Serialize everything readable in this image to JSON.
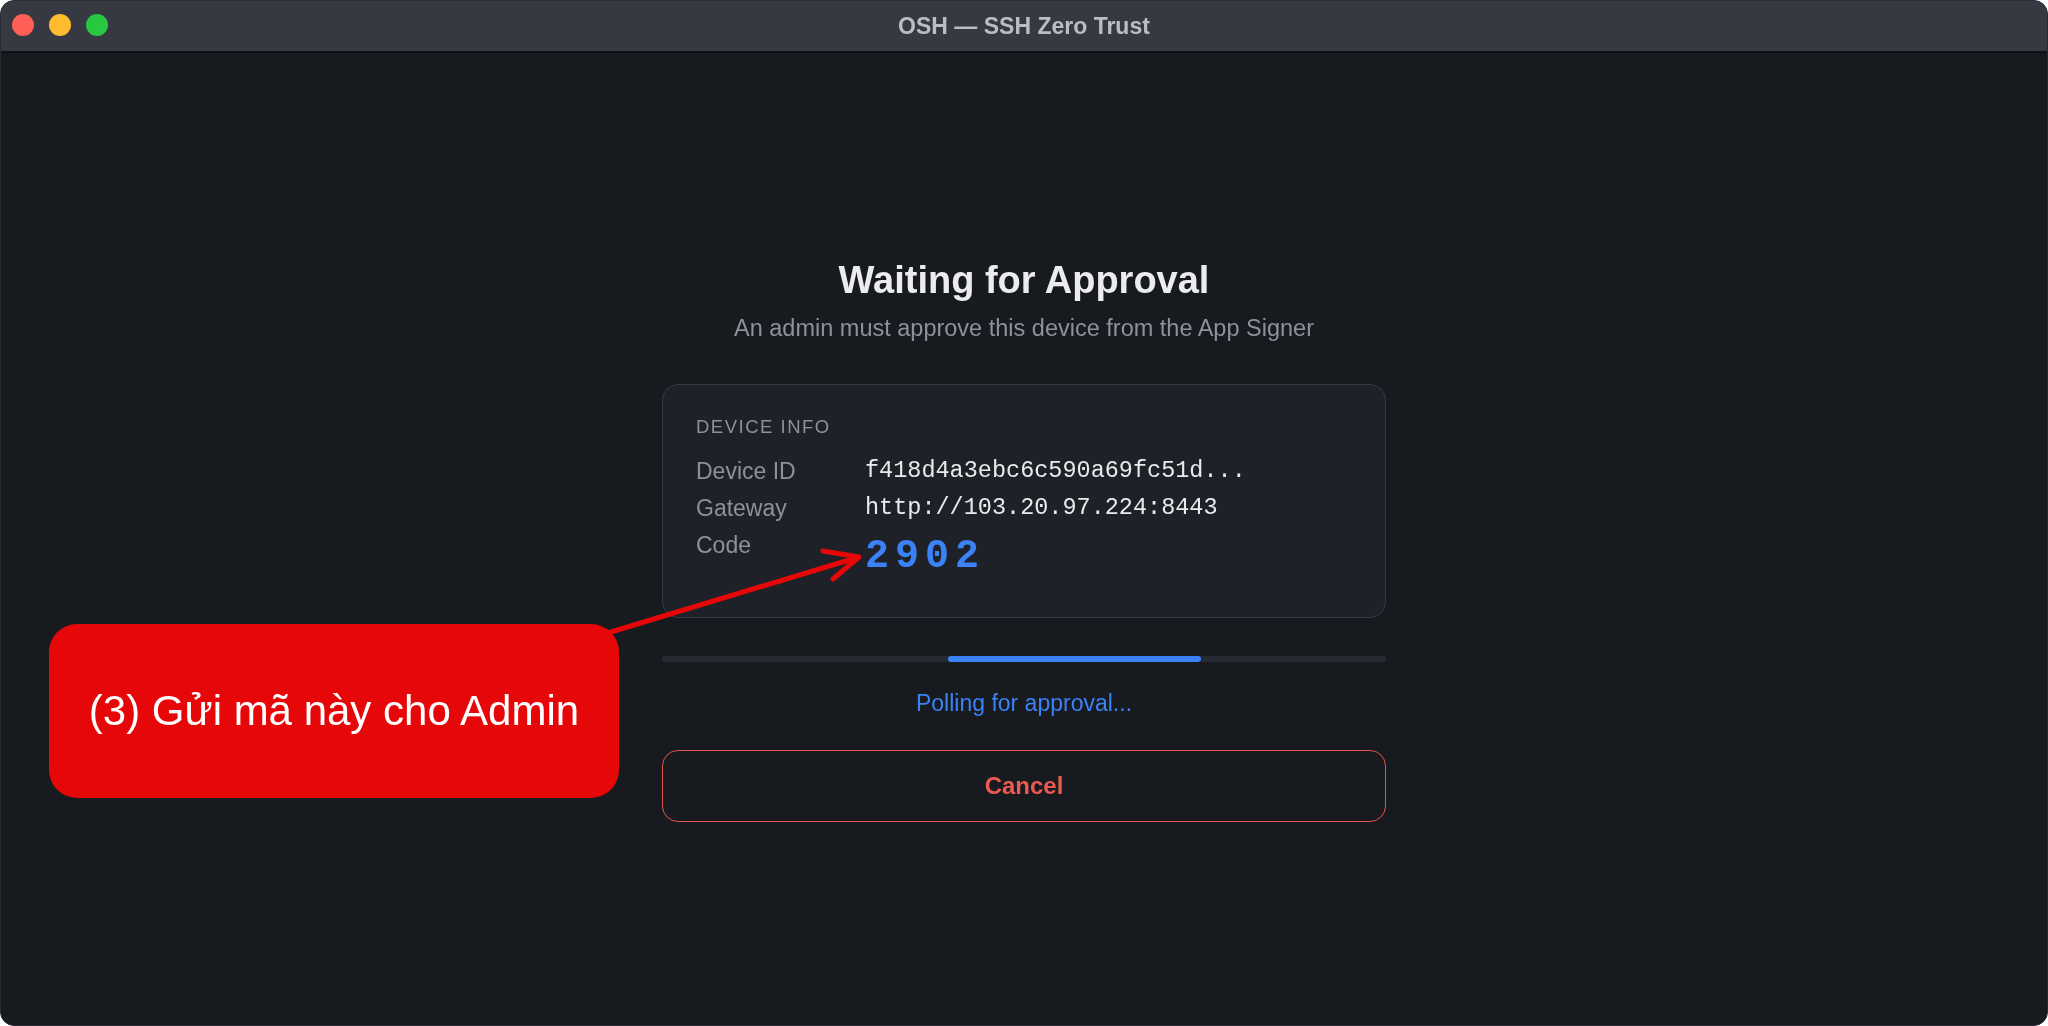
{
  "window": {
    "title": "OSH — SSH Zero Trust"
  },
  "header": {
    "title": "Waiting for Approval",
    "subtitle": "An admin must approve this device from the App Signer"
  },
  "device_info": {
    "heading": "DEVICE INFO",
    "rows": [
      {
        "kind": "text",
        "label": "Device ID",
        "value": "f418d4a3ebc6c590a69fc51d..."
      },
      {
        "kind": "text",
        "label": "Gateway",
        "value": "http://103.20.97.224:8443"
      },
      {
        "kind": "code",
        "label": "Code",
        "value": "2902"
      }
    ]
  },
  "progress": {
    "indeterminate": true,
    "status": "Polling for approval..."
  },
  "buttons": [
    {
      "kind": "cancel",
      "label": "Cancel"
    }
  ],
  "annotation": {
    "label": "(3) Gửi mã này cho Admin"
  }
}
